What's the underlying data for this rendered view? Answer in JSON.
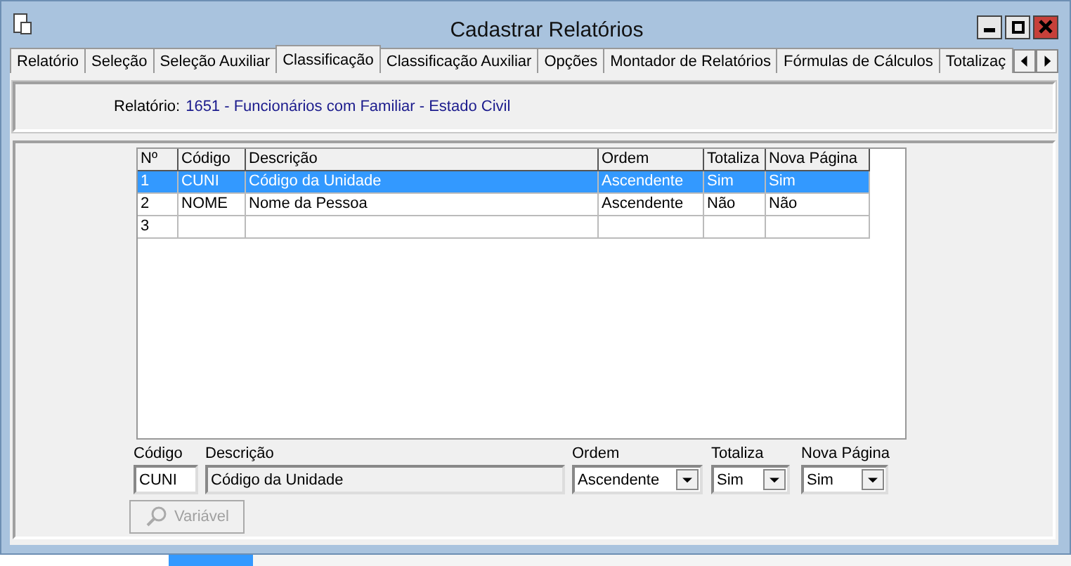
{
  "window": {
    "title": "Cadastrar Relatórios"
  },
  "tabs": [
    {
      "label": "Relatório",
      "selected": false
    },
    {
      "label": "Seleção",
      "selected": false
    },
    {
      "label": "Seleção Auxiliar",
      "selected": false
    },
    {
      "label": "Classificação",
      "selected": true
    },
    {
      "label": "Classificação Auxiliar",
      "selected": false
    },
    {
      "label": "Opções",
      "selected": false
    },
    {
      "label": "Montador de Relatórios",
      "selected": false
    },
    {
      "label": "Fórmulas de Cálculos",
      "selected": false
    },
    {
      "label": "Totalizaç",
      "selected": false
    }
  ],
  "report": {
    "label": "Relatório:",
    "value": "1651 - Funcionários com Familiar - Estado Civil"
  },
  "table": {
    "columns": [
      "Nº",
      "Código",
      "Descrição",
      "Ordem",
      "Totaliza",
      "Nova Página"
    ],
    "rows": [
      {
        "cells": [
          "1",
          "CUNI",
          "Código da Unidade",
          "Ascendente",
          "Sim",
          "Sim"
        ],
        "selected": true
      },
      {
        "cells": [
          "2",
          "NOME",
          "Nome da Pessoa",
          "Ascendente",
          "Não",
          "Não"
        ],
        "selected": false
      },
      {
        "cells": [
          "3",
          "",
          "",
          "",
          "",
          ""
        ],
        "selected": false
      }
    ]
  },
  "form": {
    "fields": [
      {
        "kind": "text",
        "label": "Código",
        "value": "CUNI"
      },
      {
        "kind": "readonly",
        "label": "Descrição",
        "value": "Código da Unidade"
      },
      {
        "kind": "select",
        "label": "Ordem",
        "value": "Ascendente"
      },
      {
        "kind": "select",
        "label": "Totaliza",
        "value": "Sim"
      },
      {
        "kind": "select",
        "label": "Nova Página",
        "value": "Sim"
      }
    ]
  },
  "button": {
    "label": "Variável",
    "disabled": true
  }
}
